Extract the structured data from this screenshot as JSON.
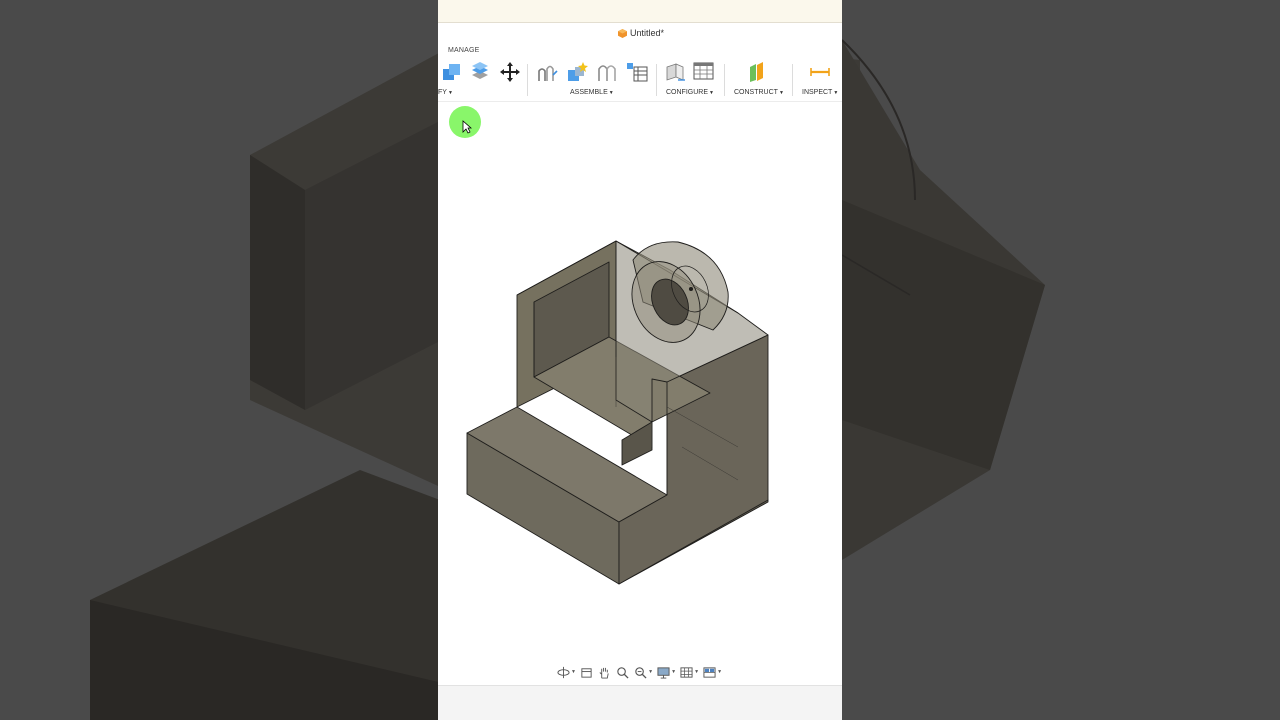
{
  "document": {
    "title": "Untitled*"
  },
  "ribbon": {
    "section_label": "MANAGE",
    "groups": [
      {
        "label": "FY"
      },
      {
        "label": "ASSEMBLE"
      },
      {
        "label": "CONFIGURE"
      },
      {
        "label": "CONSTRUCT"
      },
      {
        "label": "INSPECT"
      }
    ]
  },
  "colors": {
    "accent_blue": "#3d8fe0",
    "model_face": "#6b6658",
    "cursor_highlight": "#7cf55a",
    "construct_orange": "#f2a31a"
  }
}
